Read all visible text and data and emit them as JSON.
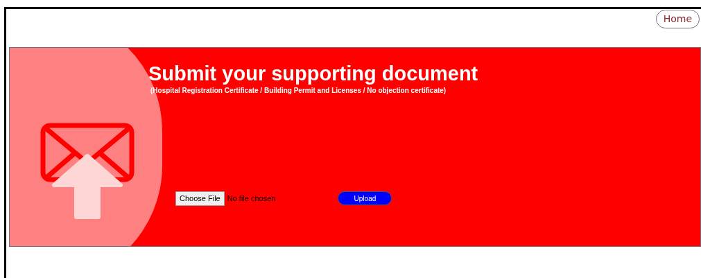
{
  "nav": {
    "home_link": "Home"
  },
  "banner": {
    "title": "Submit your supporting document",
    "subtitle": "(Hospital Registration Certificate / Building Permit and Licenses / No objection certificate)"
  },
  "file_picker": {
    "button": "Choose File",
    "status": "No file chosen"
  },
  "upload_button": "Upload"
}
